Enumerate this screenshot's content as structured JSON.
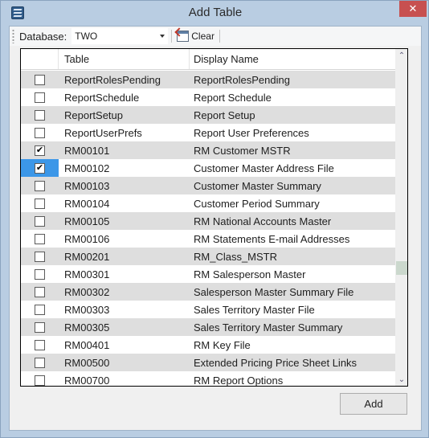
{
  "window": {
    "title": "Add Table",
    "app_icon": "app-menu-icon",
    "close_icon": "close-icon",
    "close_glyph": "✕"
  },
  "toolbar": {
    "database_label": "Database:",
    "database_value": "TWO",
    "clear_label": "Clear",
    "clear_icon": "clear-icon"
  },
  "grid": {
    "columns": [
      "",
      "Table",
      "Display Name"
    ],
    "rows": [
      {
        "checked": false,
        "table": "ReportRolesPending",
        "display_name": "ReportRolesPending"
      },
      {
        "checked": false,
        "table": "ReportSchedule",
        "display_name": "Report Schedule"
      },
      {
        "checked": false,
        "table": "ReportSetup",
        "display_name": "Report Setup"
      },
      {
        "checked": false,
        "table": "ReportUserPrefs",
        "display_name": "Report User Preferences"
      },
      {
        "checked": true,
        "table": "RM00101",
        "display_name": "RM Customer MSTR"
      },
      {
        "checked": true,
        "table": "RM00102",
        "display_name": "Customer Master Address File",
        "current": true
      },
      {
        "checked": false,
        "table": "RM00103",
        "display_name": "Customer Master Summary"
      },
      {
        "checked": false,
        "table": "RM00104",
        "display_name": "Customer Period Summary"
      },
      {
        "checked": false,
        "table": "RM00105",
        "display_name": "RM National Accounts Master"
      },
      {
        "checked": false,
        "table": "RM00106",
        "display_name": "RM Statements E-mail Addresses"
      },
      {
        "checked": false,
        "table": "RM00201",
        "display_name": "RM_Class_MSTR"
      },
      {
        "checked": false,
        "table": "RM00301",
        "display_name": "RM Salesperson Master"
      },
      {
        "checked": false,
        "table": "RM00302",
        "display_name": "Salesperson Master Summary File"
      },
      {
        "checked": false,
        "table": "RM00303",
        "display_name": "Sales Territory Master File"
      },
      {
        "checked": false,
        "table": "RM00305",
        "display_name": "Sales Territory Master Summary"
      },
      {
        "checked": false,
        "table": "RM00401",
        "display_name": "RM Key File"
      },
      {
        "checked": false,
        "table": "RM00500",
        "display_name": "Extended Pricing Price Sheet Links"
      },
      {
        "checked": false,
        "table": "RM00700",
        "display_name": "RM Report Options"
      }
    ],
    "scroll_position": 0.67,
    "scroll_up_glyph": "⌃",
    "scroll_down_glyph": "⌄"
  },
  "actions": {
    "add_label": "Add"
  },
  "colors": {
    "title_bar": "#b9cde2",
    "close_button": "#c75050",
    "alt_row": "#dedede",
    "current_cell": "#3c97e8",
    "scroll_thumb": "#cbd8cd"
  }
}
